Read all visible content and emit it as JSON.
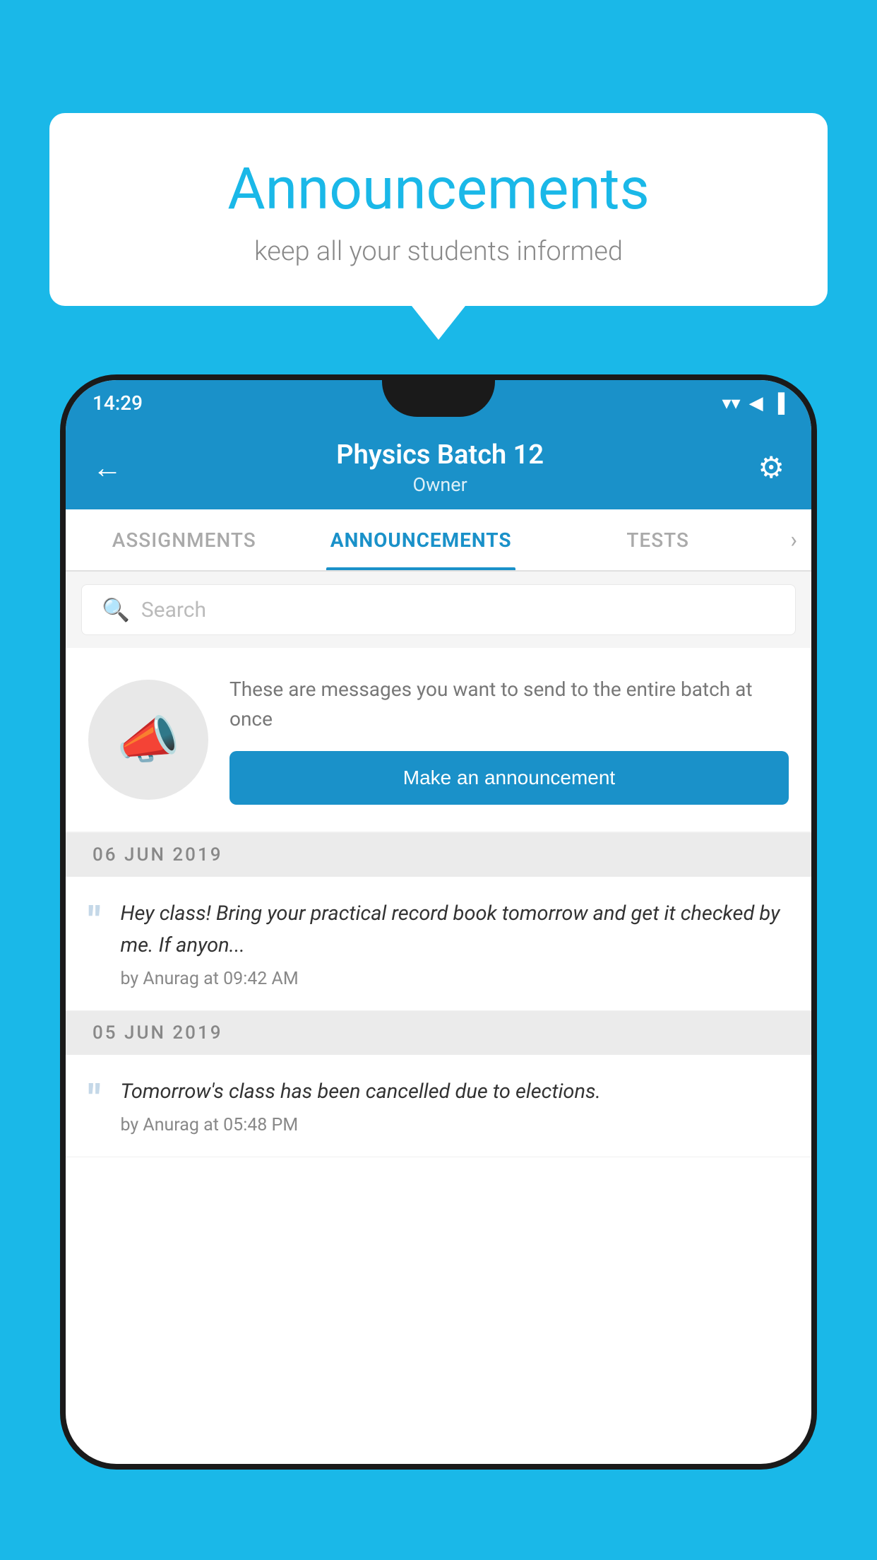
{
  "background": {
    "color": "#1ab8e8"
  },
  "speech_bubble": {
    "title": "Announcements",
    "subtitle": "keep all your students informed"
  },
  "phone": {
    "status_bar": {
      "time": "14:29",
      "wifi": "▲",
      "signal": "▲",
      "battery": "▪"
    },
    "header": {
      "back_label": "←",
      "title": "Physics Batch 12",
      "subtitle": "Owner",
      "settings_label": "⚙"
    },
    "tabs": [
      {
        "label": "ASSIGNMENTS",
        "active": false
      },
      {
        "label": "ANNOUNCEMENTS",
        "active": true
      },
      {
        "label": "TESTS",
        "active": false
      }
    ],
    "search": {
      "placeholder": "Search"
    },
    "promo": {
      "description": "These are messages you want to send to the entire batch at once",
      "button_label": "Make an announcement"
    },
    "announcements": [
      {
        "date": "06  JUN  2019",
        "text": "Hey class! Bring your practical record book tomorrow and get it checked by me. If anyon...",
        "meta": "by Anurag at 09:42 AM"
      },
      {
        "date": "05  JUN  2019",
        "text": "Tomorrow's class has been cancelled due to elections.",
        "meta": "by Anurag at 05:48 PM"
      }
    ]
  }
}
